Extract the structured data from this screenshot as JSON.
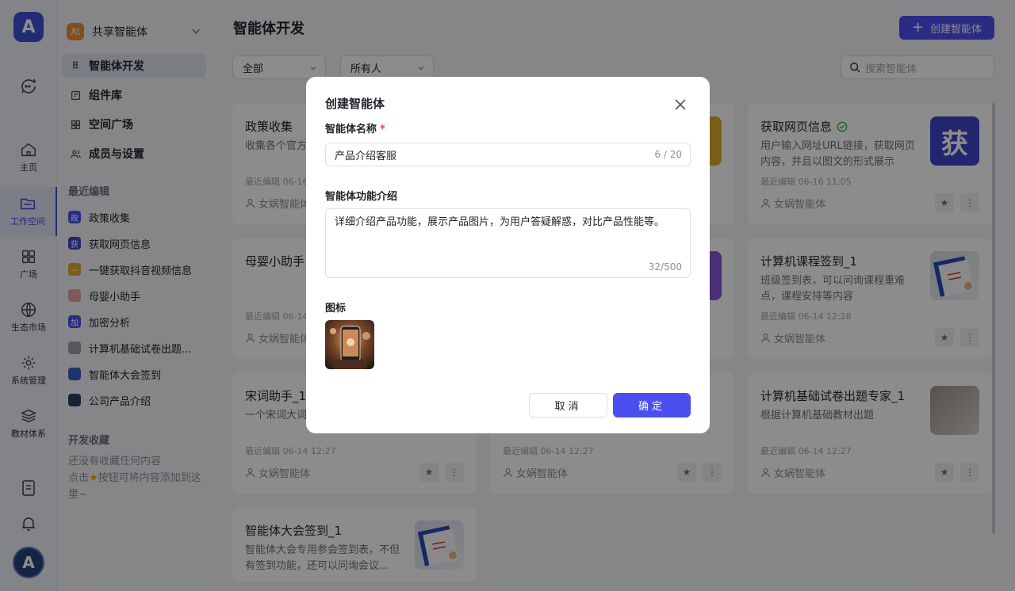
{
  "rail": {
    "logo_letter": "A",
    "items": [
      {
        "label": "主页",
        "icon": "home-icon"
      },
      {
        "label": "工作空间",
        "icon": "folder-icon"
      },
      {
        "label": "广场",
        "icon": "grid-icon"
      },
      {
        "label": "生态市场",
        "icon": "globe-icon"
      },
      {
        "label": "系统管理",
        "icon": "gear-icon"
      },
      {
        "label": "教材体系",
        "icon": "layers-icon"
      }
    ],
    "avatar_letter": "A"
  },
  "sidebar": {
    "space_name": "共享智能体",
    "menu": [
      {
        "label": "智能体开发",
        "icon": "dots-grid-icon"
      },
      {
        "label": "组件库",
        "icon": "component-icon"
      },
      {
        "label": "空间广场",
        "icon": "apps-icon"
      },
      {
        "label": "成员与设置",
        "icon": "members-icon"
      }
    ],
    "recent_title": "最近编辑",
    "recent": [
      {
        "label": "政策收集",
        "badge": "政",
        "color": "#4b4ff0"
      },
      {
        "label": "获取网页信息",
        "badge": "获",
        "color": "#3f45c8"
      },
      {
        "label": "一键获取抖音视频信息",
        "badge": "一",
        "color": "#e0a92b"
      },
      {
        "label": "母婴小助手",
        "badge": "",
        "color": "#e8a0a8"
      },
      {
        "label": "加密分析",
        "badge": "加",
        "color": "#4b4ff0"
      },
      {
        "label": "计算机基础试卷出题...",
        "badge": "",
        "color": "#9aa0a6"
      },
      {
        "label": "智能体大会签到",
        "badge": "",
        "color": "#3a5fc8"
      },
      {
        "label": "公司产品介绍",
        "badge": "",
        "color": "#2c3e60"
      }
    ],
    "fav_title": "开发收藏",
    "fav_empty_1": "还没有收藏任何内容",
    "fav_empty_2": "点击",
    "fav_empty_3": "按钮可将内容添加到这里~"
  },
  "main": {
    "title": "智能体开发",
    "create_label": "创建智能体",
    "filter_all": "全部",
    "filter_owner": "所有人",
    "search_placeholder": "搜索智能体",
    "cards": [
      {
        "title": "政策收集",
        "desc": "收集各个官方",
        "edit": "最近编辑 06-16",
        "owner": "女娲智能体"
      },
      {
        "title": "获取网页信息",
        "desc": "用户输入网址URL链接，获取网页内容，并且以图文的形式展示",
        "edit": "最近编辑 06-16 11:05",
        "owner": "女娲智能体",
        "thumb_text": "获"
      },
      {
        "title": "母婴小助手",
        "desc": "",
        "edit": "最近编辑 06-14",
        "owner": "女娲智能体"
      },
      {
        "title": "计算机课程签到_1",
        "desc": "班级签到表，可以问询课程重难点，课程安排等内容",
        "edit": "最近编辑 06-14 12:28",
        "owner": "女娲智能体"
      },
      {
        "title": "宋词助手_1",
        "desc": "一个宋词大词",
        "edit": "最近编辑 06-14 12:27",
        "owner": "女娲智能体"
      },
      {
        "title": "",
        "desc": "",
        "edit": "最近编辑 06-14 12:27",
        "owner": "女娲智能体"
      },
      {
        "title": "计算机基础试卷出题专家_1",
        "desc": "根据计算机基础教材出题",
        "edit": "最近编辑 06-14 12:27",
        "owner": "女娲智能体"
      },
      {
        "title": "智能体大会签到_1",
        "desc": "智能体大会专用参会签到表，不但有签到功能，还可以问询会议...",
        "edit": "",
        "owner": ""
      }
    ]
  },
  "modal": {
    "title": "创建智能体",
    "name_label": "智能体名称",
    "required_mark": "*",
    "name_value": "产品介绍客服",
    "name_count": "6 / 20",
    "intro_label": "智能体功能介绍",
    "intro_value": "详细介绍产品功能，展示产品图片，为用户答疑解惑，对比产品性能等。",
    "intro_count": "32/500",
    "icon_label": "图标",
    "cancel_label": "取消",
    "ok_label": "确定"
  }
}
